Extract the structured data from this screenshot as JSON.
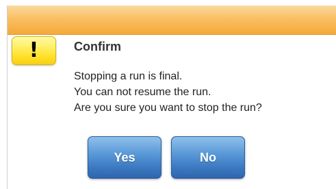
{
  "dialog": {
    "icon": "warning-exclamation-icon",
    "icon_glyph": "!",
    "title": "Confirm",
    "message_lines": [
      "Stopping a run is final.",
      "You can not resume the run.",
      "Are you sure you want to stop the run?"
    ],
    "buttons": {
      "yes_label": "Yes",
      "no_label": "No"
    }
  },
  "colors": {
    "titlebar": "#f9bf62",
    "warning_icon": "#ffe12a",
    "button": "#4a88cc"
  }
}
